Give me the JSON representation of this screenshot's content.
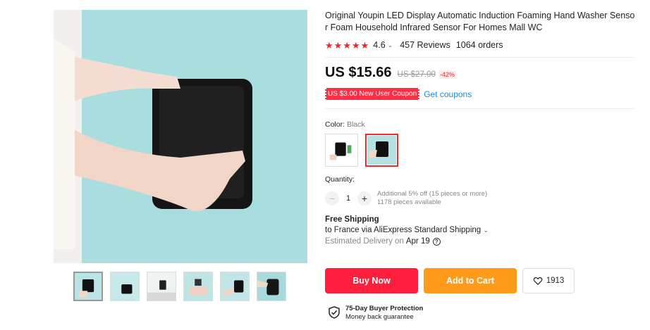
{
  "product": {
    "title": "Original Youpin LED Display Automatic Induction Foaming Hand Washer Sensor Foam Household Infrared Sensor For Homes Mall WC",
    "rating": "4.6",
    "reviews": "457 Reviews",
    "orders": "1064 orders",
    "stars_filled": 5
  },
  "price": {
    "current": "US $15.66",
    "original": "US $27.00",
    "discount": "-42%"
  },
  "coupon": {
    "label": "US $3.00 New User Coupon",
    "link": "Get coupons"
  },
  "color": {
    "label": "Color:",
    "value": "Black"
  },
  "quantity": {
    "label": "Quantity:",
    "value": "1",
    "minus": "−",
    "plus": "+",
    "note1": "Additional 5% off (15 pieces or more)",
    "note2": "1178 pieces available"
  },
  "shipping": {
    "title": "Free Shipping",
    "line": "to France via AliExpress Standard Shipping",
    "est_label": "Estimated Delivery on",
    "est_date": "Apr 19"
  },
  "actions": {
    "buy": "Buy Now",
    "cart": "Add to Cart",
    "wishlist_count": "1913"
  },
  "protection": {
    "title": "75-Day Buyer Protection",
    "subtitle": "Money back guarantee"
  },
  "colors": {
    "accent_red": "#ff1f3d",
    "accent_orange": "#ff9a1a",
    "link_blue": "#1a8ad6",
    "star_red": "#f5222d"
  },
  "icons": [
    "star-icon",
    "chevron-down-icon",
    "help-circle-icon",
    "heart-icon",
    "shield-check-icon"
  ]
}
